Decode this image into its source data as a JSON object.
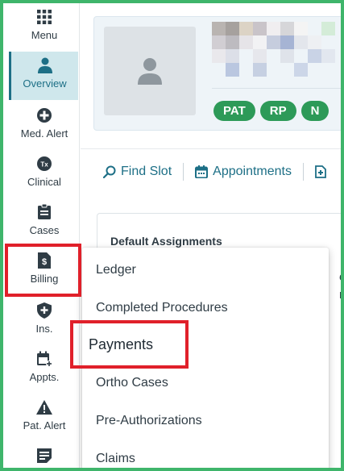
{
  "sidebar": {
    "items": [
      {
        "label": "Menu",
        "icon": "grid-icon"
      },
      {
        "label": "Overview",
        "icon": "person-icon",
        "active": true
      },
      {
        "label": "Med. Alert",
        "icon": "plus-circle-icon"
      },
      {
        "label": "Clinical",
        "icon": "tx-icon"
      },
      {
        "label": "Cases",
        "icon": "clipboard-icon"
      },
      {
        "label": "Billing",
        "icon": "dollar-doc-icon"
      },
      {
        "label": "Ins.",
        "icon": "shield-icon"
      },
      {
        "label": "Appts.",
        "icon": "calendar-add-icon"
      },
      {
        "label": "Pat. Alert",
        "icon": "warning-icon"
      },
      {
        "label": "",
        "icon": "note-icon"
      }
    ]
  },
  "patient": {
    "tags": [
      "PAT",
      "RP",
      "N"
    ]
  },
  "toolbar": {
    "find_slot": "Find Slot",
    "appointments": "Appointments"
  },
  "assignments": {
    "title": "Default Assignments",
    "peek_line1": "ele",
    "peek_line2": "rc"
  },
  "billing_menu": {
    "items": [
      "Ledger",
      "Completed Procedures",
      "Payments",
      "Ortho Cases",
      "Pre-Authorizations",
      "Claims"
    ]
  },
  "colors": {
    "accent": "#1d6f86",
    "tag_green": "#2d9a58",
    "highlight_red": "#e0202a",
    "frame_green": "#3fb56b"
  }
}
